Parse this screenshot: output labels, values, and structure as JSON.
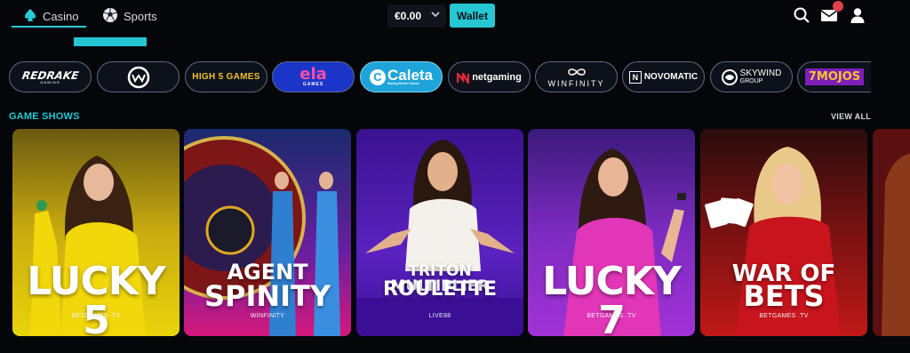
{
  "nav": {
    "tabs": [
      {
        "label": "Casino",
        "icon": "spade-icon",
        "active": true
      },
      {
        "label": "Sports",
        "icon": "soccer-ball-icon",
        "active": false
      }
    ]
  },
  "header": {
    "balance": "€0.00",
    "wallet_label": "Wallet",
    "icons": [
      "search-icon",
      "mail-icon",
      "user-icon"
    ]
  },
  "providers": [
    {
      "name": "REDRAKE",
      "sub": "GAMING"
    },
    {
      "name": "WINFINITY"
    },
    {
      "name": "HIGH 5 GAMES"
    },
    {
      "name": "ela",
      "sub": "GAMES"
    },
    {
      "name": "Caleta",
      "sub": "Making Better Games"
    },
    {
      "name": "netgaming"
    },
    {
      "name": "WINFINITY"
    },
    {
      "name": "NOVOMATIC"
    },
    {
      "name": "SKYWIND",
      "sub": "GROUP"
    },
    {
      "name": "7MOJOS"
    }
  ],
  "section": {
    "title": "GAME SHOWS",
    "view_all": "VIEW ALL"
  },
  "games": [
    {
      "line1": "LUCKY 5",
      "line2": "",
      "provider": "BETGAMES .TV"
    },
    {
      "line1": "AGENT",
      "line2": "SPINITY",
      "provider": "WINFINITY"
    },
    {
      "line1": "TRITON MULTIPLIER",
      "line2": "ROULETTE",
      "provider": "LIVE88"
    },
    {
      "line1": "LUCKY 7",
      "line2": "",
      "provider": "BETGAMES .TV"
    },
    {
      "line1": "WAR OF",
      "line2": "BETS",
      "provider": "BETGAMES .TV"
    }
  ],
  "colors": {
    "accent": "#26c6d2",
    "background": "#05060a",
    "notification": "#e0404c"
  }
}
